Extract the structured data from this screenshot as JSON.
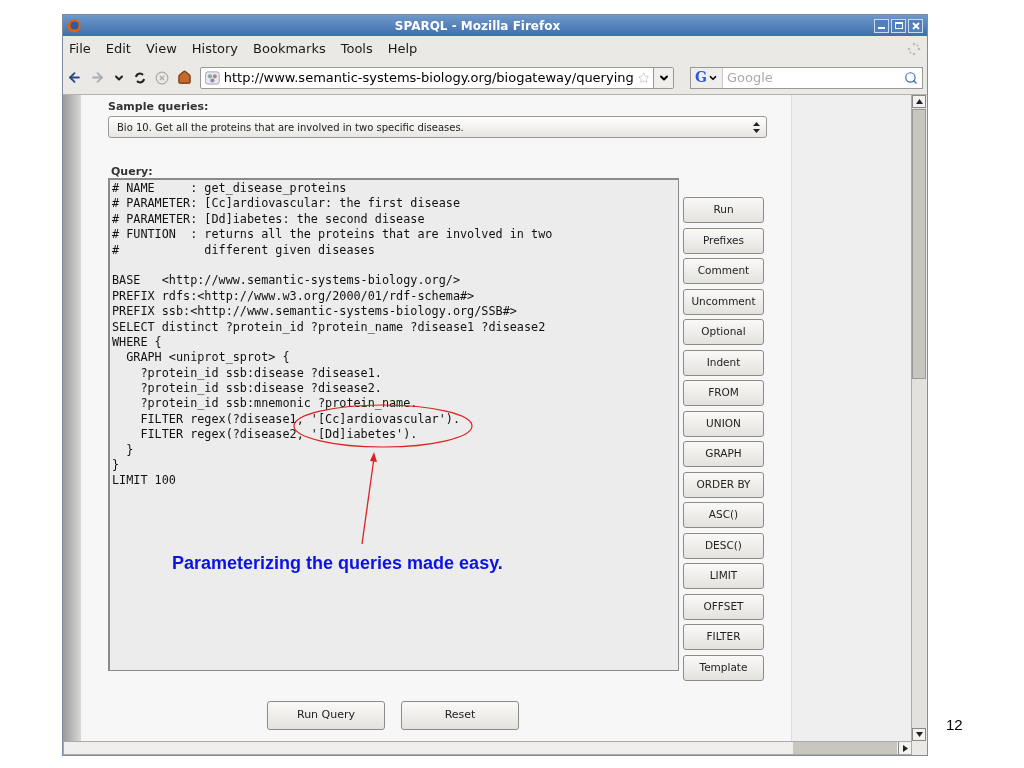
{
  "window": {
    "title": "SPARQL - Mozilla Firefox"
  },
  "menu": [
    "File",
    "Edit",
    "View",
    "History",
    "Bookmarks",
    "Tools",
    "Help"
  ],
  "address": {
    "value": "http://www.semantic-systems-biology.org/biogateway/querying"
  },
  "search": {
    "engine_label": "G",
    "placeholder": "Google"
  },
  "page": {
    "sample_label": "Sample queries:",
    "sample_select": "Bio 10. Get all the proteins that are involved in two specific diseases.",
    "query_label": "Query:",
    "query_blocks": [
      [
        "# NAME     : get_disease_proteins",
        "# PARAMETER: [Cc]ardiovascular: the first disease",
        "# PARAMETER: [Dd]iabetes: the second disease",
        "# FUNTION  : returns all the proteins that are involved in two",
        "#            different given diseases"
      ],
      [
        "BASE   <http://www.semantic-systems-biology.org/>",
        "PREFIX rdfs:<http://www.w3.org/2000/01/rdf-schema#>",
        "PREFIX ssb:<http://www.semantic-systems-biology.org/SSB#>",
        "SELECT distinct ?protein_id ?protein_name ?disease1 ?disease2",
        "WHERE {",
        "  GRAPH <uniprot_sprot> {",
        "    ?protein_id ssb:disease ?disease1.",
        "    ?protein_id ssb:disease ?disease2.",
        "    ?protein_id ssb:mnemonic ?protein_name.",
        "    FILTER regex(?disease1, '[Cc]ardiovascular').",
        "    FILTER regex(?disease2, '[Dd]iabetes').",
        "  }",
        "}",
        "LIMIT 100"
      ]
    ],
    "side_buttons": [
      "Run",
      "Prefixes",
      "Comment",
      "Uncomment",
      "Optional",
      "Indent",
      "FROM",
      "UNION",
      "GRAPH",
      "ORDER BY",
      "ASC()",
      "DESC()",
      "LIMIT",
      "OFFSET",
      "FILTER",
      "Template"
    ],
    "bottom_buttons": [
      "Run Query",
      "Reset"
    ]
  },
  "annotation": "Parameterizing the queries made easy.",
  "slide_number": "12"
}
